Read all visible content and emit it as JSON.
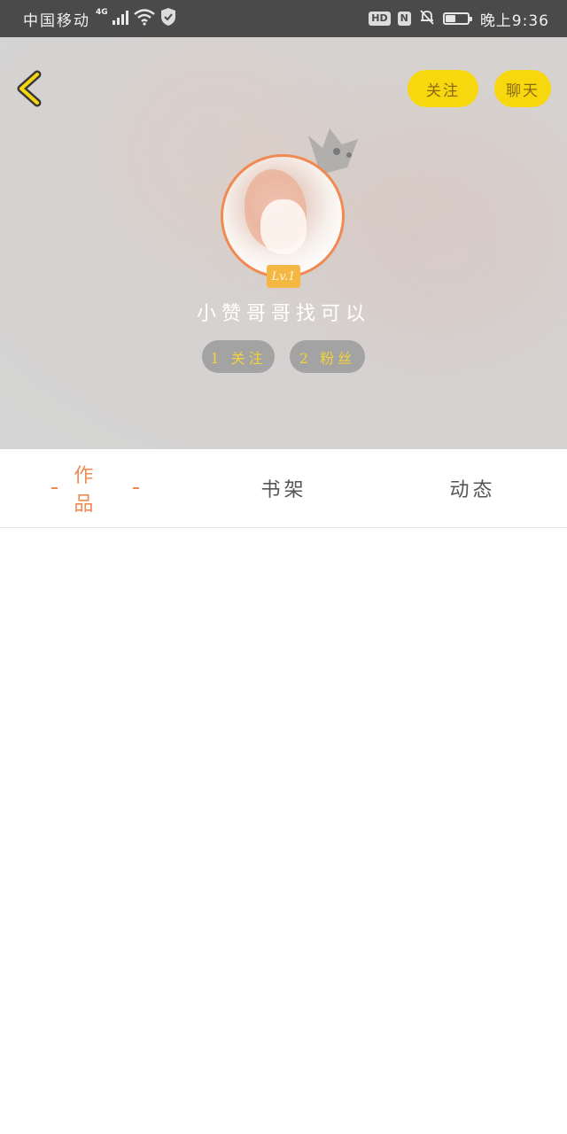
{
  "status_bar": {
    "carrier": "中国移动",
    "network_type": "4G",
    "hd_badge": "HD",
    "nfc_badge": "N",
    "battery_level": 0.45,
    "time": "晚上9:36"
  },
  "header": {
    "back_icon": "chevron-left-icon",
    "follow_button_label": "关注",
    "chat_button_label": "聊天"
  },
  "profile": {
    "level_label": "Lv.1",
    "username": "小赞哥哥找可以",
    "following_stat": "1 关注",
    "fans_stat": "2 粉丝",
    "colors": {
      "accent": "#f08a52",
      "button_yellow": "#f7d80e",
      "level_badge": "#f4b742"
    }
  },
  "tabs": {
    "items": [
      {
        "label": "作品",
        "active": true
      },
      {
        "label": "书架",
        "active": false
      },
      {
        "label": "动态",
        "active": false
      }
    ]
  }
}
